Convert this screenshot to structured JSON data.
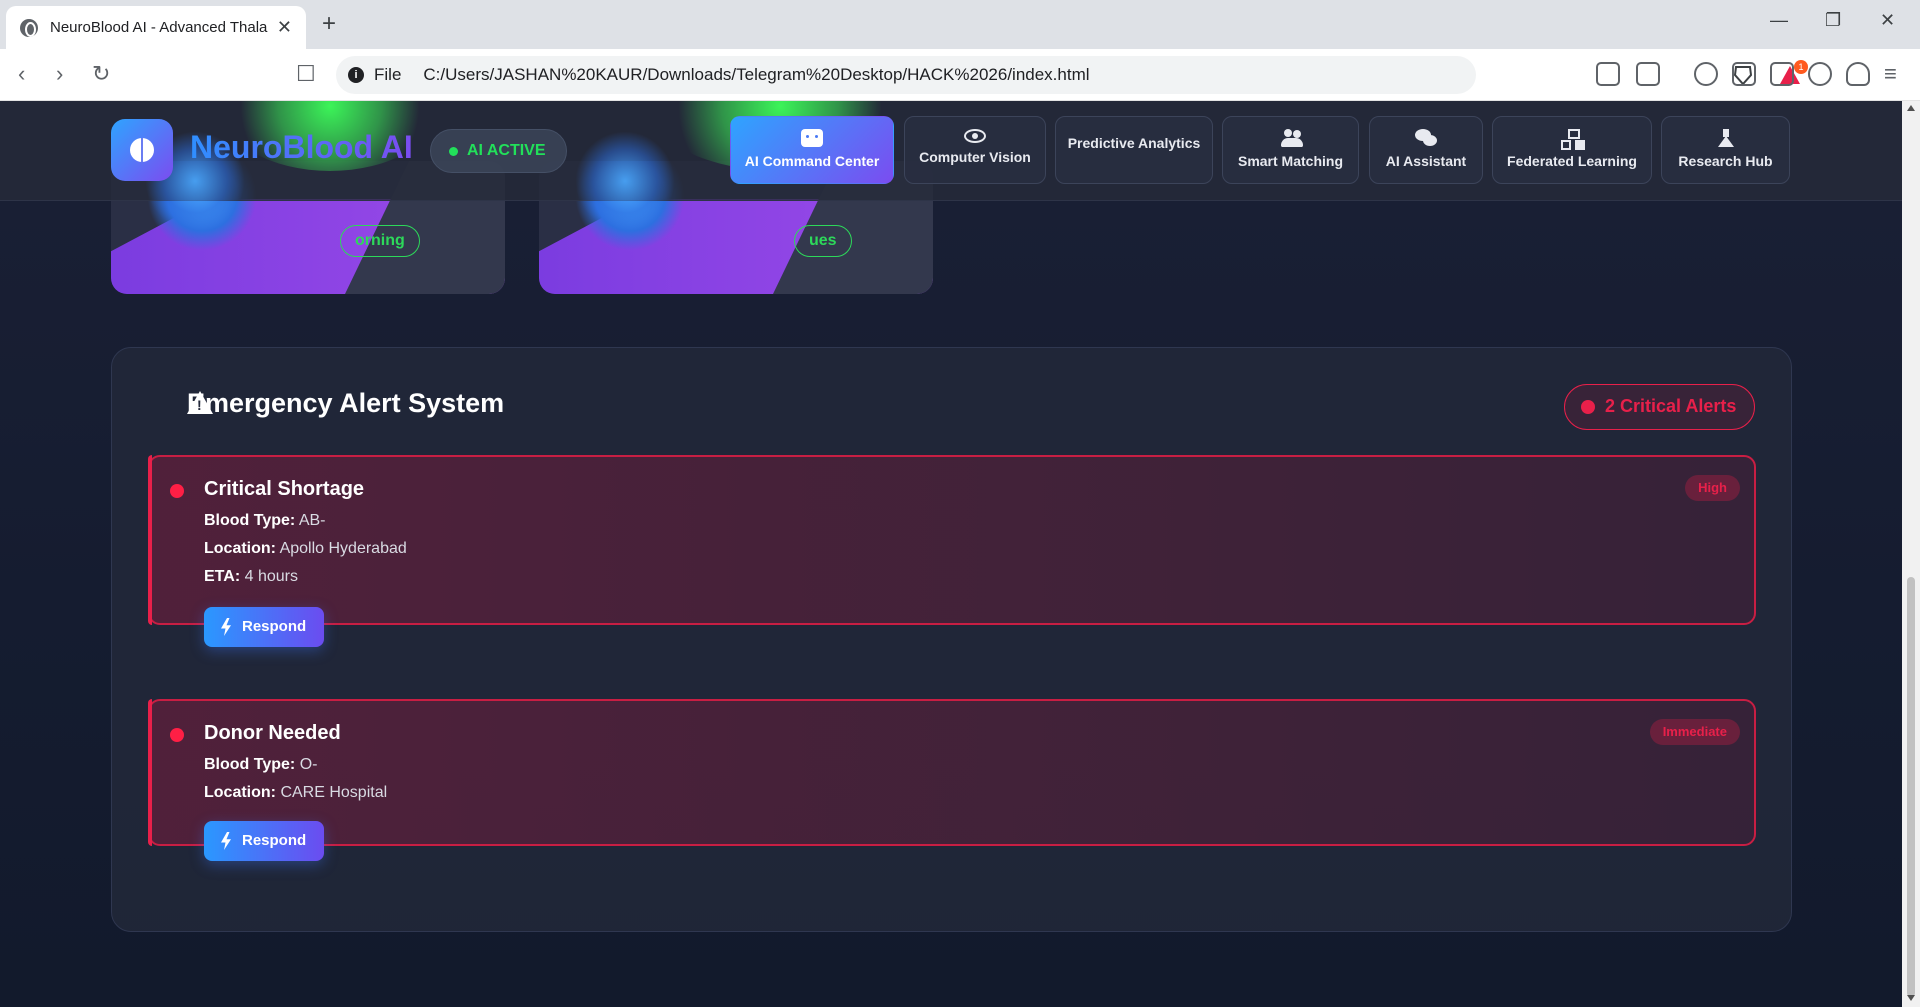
{
  "browser": {
    "tab_title": "NeuroBlood AI - Advanced Thala",
    "tab_close": "✕",
    "new_tab": "+",
    "address_scheme": "File",
    "address_url": "C:/Users/JASHAN%20KAUR/Downloads/Telegram%20Desktop/HACK%2026/index.html",
    "rewards_badge": "1"
  },
  "header": {
    "brand": "NeuroBlood AI",
    "status": "AI ACTIVE",
    "nav": [
      {
        "label": "AI Command Center",
        "icon": "robot-icon",
        "active": true
      },
      {
        "label": "Computer Vision",
        "icon": "eye-icon",
        "active": false
      },
      {
        "label": "Predictive Analytics",
        "icon": "",
        "active": false
      },
      {
        "label": "Smart Matching",
        "icon": "users-icon",
        "active": false
      },
      {
        "label": "AI Assistant",
        "icon": "chat-icon",
        "active": false
      },
      {
        "label": "Federated Learning",
        "icon": "network-icon",
        "active": false
      },
      {
        "label": "Research Hub",
        "icon": "flask-icon",
        "active": false
      }
    ]
  },
  "cards": [
    {
      "pill": "orning"
    },
    {
      "pill": "ues"
    }
  ],
  "emergency": {
    "title": "Emergency Alert System",
    "badge": "2 Critical Alerts",
    "alerts": [
      {
        "title": "Critical Shortage",
        "severity": "High",
        "blood_type_label": "Blood Type:",
        "blood_type": "AB-",
        "location_label": "Location:",
        "location": "Apollo Hyderabad",
        "eta_label": "ETA:",
        "eta": "4 hours",
        "button": "Respond"
      },
      {
        "title": "Donor Needed",
        "severity": "Immediate",
        "blood_type_label": "Blood Type:",
        "blood_type": "O-",
        "location_label": "Location:",
        "location": "CARE Hospital",
        "button": "Respond"
      }
    ]
  },
  "colors": {
    "accent_blue": "#2ea4ff",
    "accent_purple": "#7b4cf0",
    "active_green": "#22e05a",
    "alert_red": "#e8204a"
  }
}
